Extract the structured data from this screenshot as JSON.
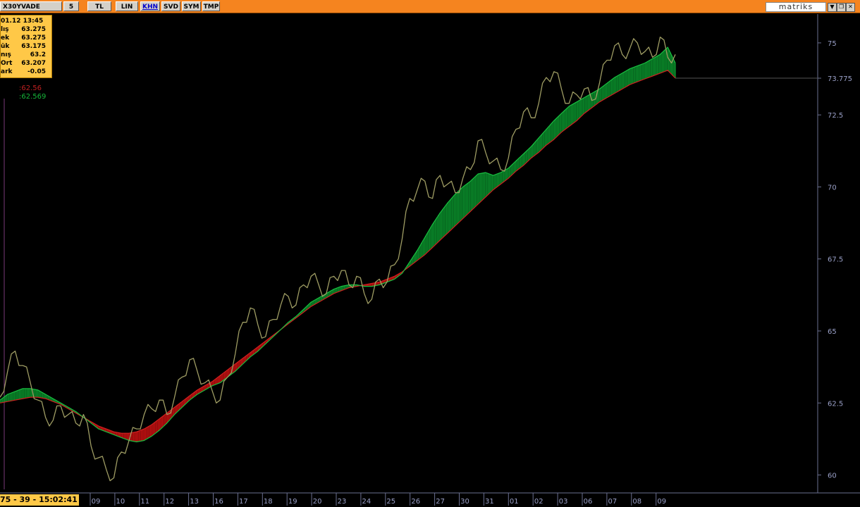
{
  "toolbar": {
    "symbol": "X30YVADE",
    "buttons": [
      "5",
      "TL",
      "LIN",
      "KHN",
      "SVD",
      "SYM",
      "TMP"
    ],
    "active": "KHN",
    "brand": "matriks",
    "dropdown_icon": "triangle-down-icon",
    "restore_icon": "window-restore-icon",
    "close_icon": "close-icon"
  },
  "info": {
    "timestamp": "01.12 13:45",
    "rows": [
      {
        "label": "lış",
        "value": "63.275"
      },
      {
        "label": "ek",
        "value": "63.275"
      },
      {
        "label": "ük",
        "value": "63.175"
      },
      {
        "label": "nış",
        "value": "63.2"
      },
      {
        "label": "Ort",
        "value": "63.207"
      },
      {
        "label": "ark",
        "value": "-0.05"
      }
    ]
  },
  "indicators": {
    "red_value": ":62.56",
    "green_value": ":62.569"
  },
  "status": "75 - 39 - 15:02:41",
  "colors": {
    "price": "#9e9c63",
    "fill_up": "#0a8a2a",
    "fill_down": "#c01010",
    "red_line": "#d02020",
    "green_line": "#18c040",
    "axis_text": "#9aa0c8"
  },
  "chart_data": {
    "type": "line",
    "y_ticks": [
      "75",
      "73.775",
      "72.5",
      "70",
      "67.5",
      "65",
      "62.5",
      "60"
    ],
    "ylim": [
      59.5,
      76
    ],
    "last_value": "73.775",
    "x_labels": [
      "09",
      "10",
      "11",
      "12",
      "13",
      "16",
      "17",
      "18",
      "19",
      "20",
      "23",
      "24",
      "25",
      "26",
      "27",
      "30",
      "31",
      "01",
      "02",
      "03",
      "06",
      "07",
      "08",
      "09"
    ],
    "series": [
      {
        "values": [
          62.7,
          63.6,
          64.3,
          63.8,
          63.2,
          62.6,
          62.0,
          61.9,
          62.4,
          62.1,
          61.8,
          62.1,
          61.0,
          60.6,
          60.2,
          59.9,
          60.8,
          61.2,
          61.6,
          62.1,
          62.3,
          62.6,
          62.1,
          62.7,
          63.4,
          64.0,
          63.6,
          63.2,
          62.9,
          62.6,
          63.4,
          64.2,
          65.3,
          65.8,
          65.2,
          64.8,
          65.4,
          65.9,
          66.2,
          65.9,
          66.6,
          66.9,
          66.6,
          66.3,
          66.9,
          67.1,
          66.6,
          66.9,
          66.3,
          66.1,
          66.8,
          66.7,
          67.3,
          68.2,
          69.6,
          69.9,
          70.2,
          69.6,
          70.4,
          70.1,
          69.8,
          70.3,
          70.6,
          71.6,
          71.2,
          70.9,
          70.6,
          71.0,
          72.0,
          72.6,
          72.4,
          72.9,
          73.8,
          74.0,
          73.4,
          72.9,
          73.2,
          73.4,
          73.0,
          73.6,
          74.4,
          74.9,
          74.6,
          74.8,
          75.0,
          74.7,
          74.5,
          75.2,
          74.5,
          74.6
        ]
      },
      {
        "values": [
          62.6,
          62.8,
          62.9,
          63.0,
          63.0,
          62.95,
          62.8,
          62.65,
          62.5,
          62.35,
          62.2,
          62.0,
          61.8,
          61.6,
          61.5,
          61.4,
          61.3,
          61.2,
          61.15,
          61.2,
          61.35,
          61.55,
          61.8,
          62.1,
          62.35,
          62.6,
          62.8,
          62.95,
          63.1,
          63.2,
          63.4,
          63.6,
          63.85,
          64.1,
          64.3,
          64.55,
          64.8,
          65.05,
          65.3,
          65.5,
          65.75,
          66.0,
          66.15,
          66.3,
          66.45,
          66.55,
          66.6,
          66.6,
          66.55,
          66.55,
          66.6,
          66.7,
          66.8,
          67.0,
          67.4,
          67.8,
          68.25,
          68.7,
          69.1,
          69.45,
          69.75,
          70.0,
          70.2,
          70.45,
          70.5,
          70.4,
          70.5,
          70.65,
          70.9,
          71.15,
          71.4,
          71.7,
          72.0,
          72.3,
          72.55,
          72.8,
          72.95,
          73.1,
          73.25,
          73.4,
          73.6,
          73.8,
          73.95,
          74.1,
          74.2,
          74.3,
          74.45,
          74.6,
          74.85,
          74.3
        ]
      },
      {
        "values": [
          62.5,
          62.55,
          62.6,
          62.65,
          62.7,
          62.7,
          62.65,
          62.55,
          62.45,
          62.3,
          62.15,
          62.0,
          61.85,
          61.7,
          61.6,
          61.5,
          61.45,
          61.45,
          61.5,
          61.6,
          61.75,
          61.95,
          62.15,
          62.35,
          62.55,
          62.75,
          62.95,
          63.1,
          63.25,
          63.45,
          63.65,
          63.85,
          64.05,
          64.25,
          64.45,
          64.65,
          64.85,
          65.05,
          65.25,
          65.45,
          65.65,
          65.85,
          66.0,
          66.15,
          66.3,
          66.4,
          66.5,
          66.55,
          66.6,
          66.65,
          66.7,
          66.8,
          66.9,
          67.05,
          67.25,
          67.45,
          67.65,
          67.9,
          68.15,
          68.4,
          68.65,
          68.9,
          69.15,
          69.4,
          69.65,
          69.9,
          70.1,
          70.3,
          70.55,
          70.75,
          71.0,
          71.2,
          71.45,
          71.65,
          71.9,
          72.1,
          72.3,
          72.55,
          72.75,
          72.95,
          73.1,
          73.25,
          73.4,
          73.55,
          73.65,
          73.75,
          73.85,
          73.95,
          74.05,
          73.775
        ]
      }
    ]
  }
}
